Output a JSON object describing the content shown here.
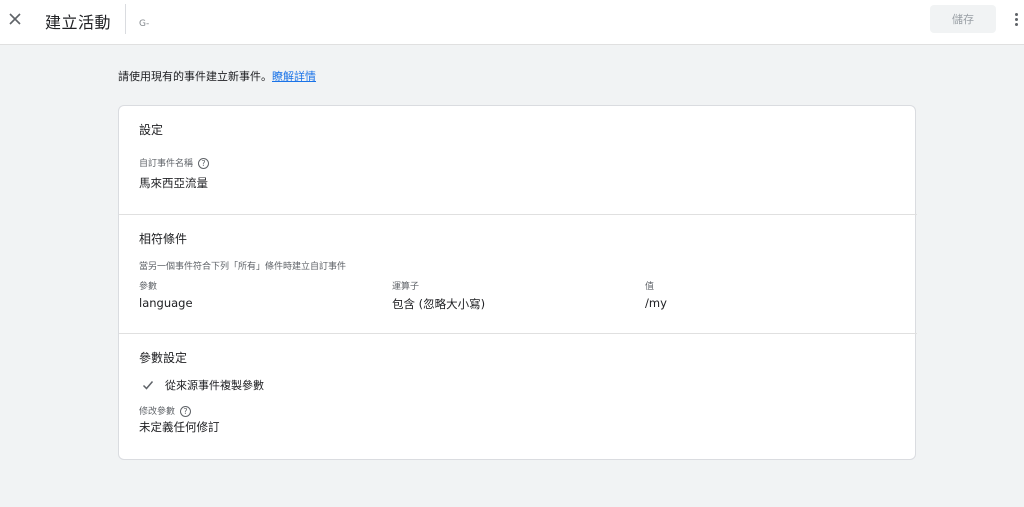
{
  "header": {
    "title": "建立活動",
    "id_prefix": "G-",
    "save_label": "儲存"
  },
  "intro": {
    "text": "請使用現有的事件建立新事件。",
    "link": "瞭解詳情"
  },
  "settings": {
    "section_title": "設定",
    "event_name_label": "自訂事件名稱",
    "event_name_value": "馬來西亞流量"
  },
  "conditions": {
    "section_title": "相符條件",
    "description": "當另一個事件符合下列「所有」條件時建立自訂事件",
    "columns": [
      "參數",
      "運算子",
      "值"
    ],
    "rows": [
      {
        "parameter": "language",
        "operator": "包含 (忽略大小寫)",
        "value": "/my"
      }
    ]
  },
  "param_config": {
    "section_title": "參數設定",
    "copy_params_label": "從來源事件複製參數",
    "modify_label": "修改參數",
    "modify_value": "未定義任何修訂"
  },
  "icons": {
    "close": "close-icon",
    "help": "help-circle-icon",
    "check": "check-icon",
    "more": "more-vert-icon"
  },
  "colors": {
    "link": "#1a73e8",
    "background": "#f1f3f4",
    "card": "#ffffff"
  }
}
